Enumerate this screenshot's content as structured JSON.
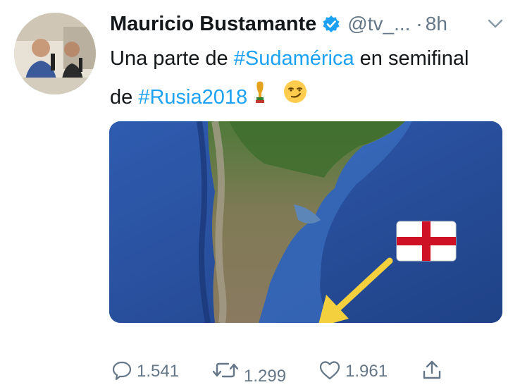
{
  "tweet": {
    "author": {
      "name": "Mauricio Bustamante",
      "handle": "@tv_...",
      "verified": true
    },
    "time_separator": "·",
    "time": "8h",
    "text": {
      "part1": "Una parte de ",
      "hashtag1": "#Sudamérica",
      "part2": " en semifinal de ",
      "hashtag2": "#Rusia2018"
    },
    "media": {
      "subject": "satellite-map-south-america",
      "overlay_flag": "england-flag",
      "overlay_arrow": "yellow-arrow"
    },
    "actions": {
      "replies": "1.541",
      "retweets": "1.299",
      "likes": "1.961"
    }
  },
  "colors": {
    "hashtag": "#1da1f2",
    "secondary_text": "#657786",
    "verified": "#1da1f2",
    "ocean": "#2a4f9a",
    "arrow": "#f4d03f",
    "flag_cross": "#ce1124"
  }
}
